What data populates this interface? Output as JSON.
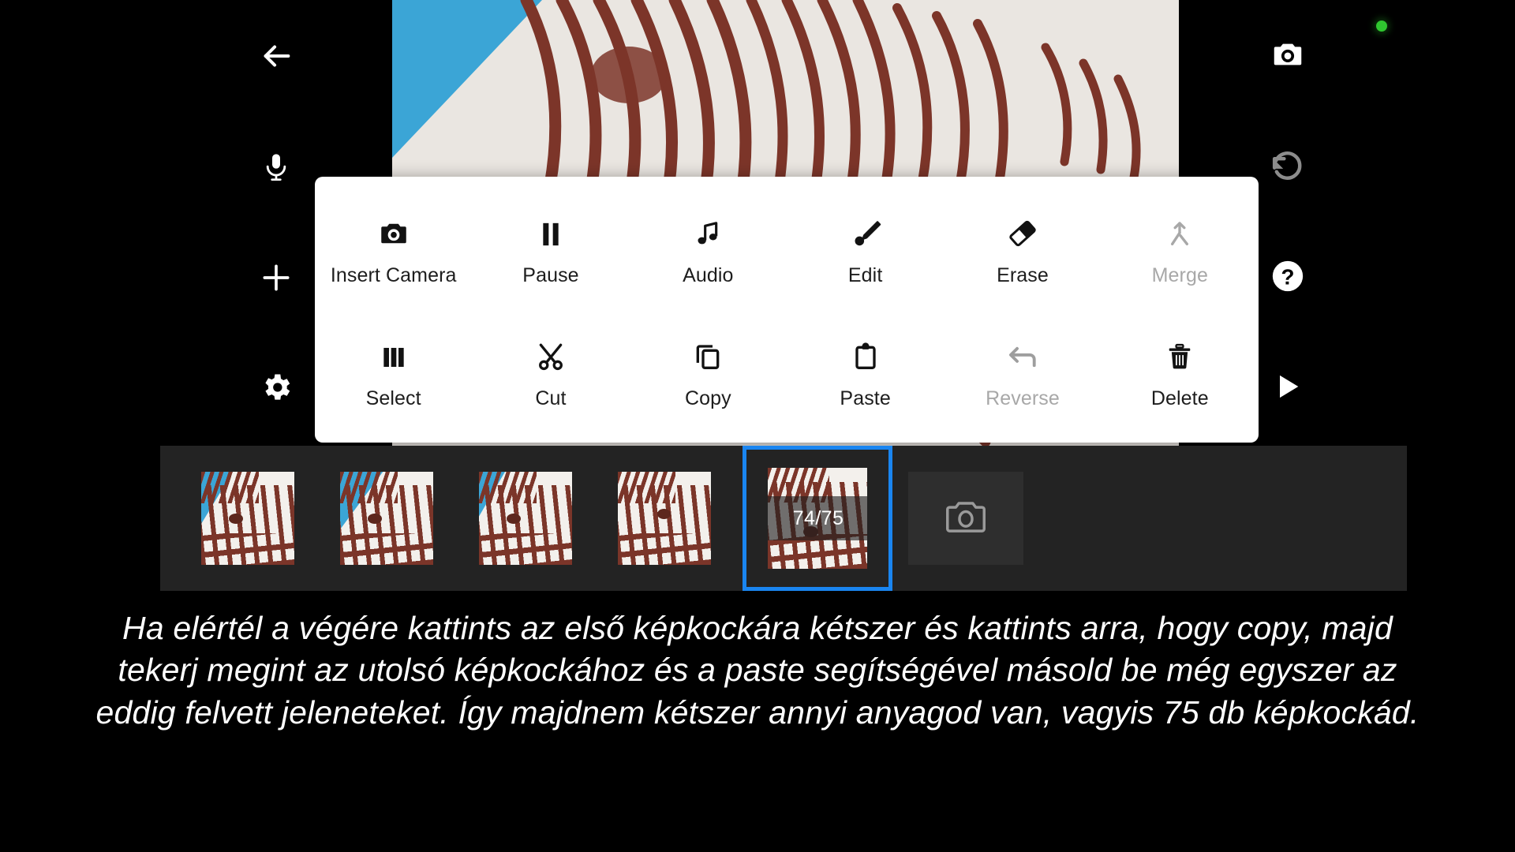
{
  "app": {
    "background_color": "#000000",
    "accent_color": "#1a85f0",
    "status_dot_color": "#2fc72f",
    "disabled_color": "#a8a8a8"
  },
  "status_indicator": {
    "name": "recording-indicator"
  },
  "left_rail": {
    "items": [
      {
        "icon": "back-arrow-icon",
        "label": "Back",
        "enabled": true
      },
      {
        "icon": "microphone-icon",
        "label": "Microphone",
        "enabled": true
      },
      {
        "icon": "plus-icon",
        "label": "Add",
        "enabled": true
      },
      {
        "icon": "settings-gear-icon",
        "label": "Settings",
        "enabled": true
      }
    ]
  },
  "right_rail": {
    "items": [
      {
        "icon": "camera-shutter-icon",
        "label": "Capture",
        "enabled": true
      },
      {
        "icon": "undo-icon",
        "label": "Undo",
        "enabled": false
      },
      {
        "icon": "help-circle-icon",
        "label": "Help",
        "enabled": true
      },
      {
        "icon": "play-icon",
        "label": "Play",
        "enabled": true
      }
    ]
  },
  "action_menu": {
    "rows": [
      [
        {
          "label": "Insert Camera",
          "icon": "camera-icon",
          "enabled": true
        },
        {
          "label": "Pause",
          "icon": "pause-icon",
          "enabled": true
        },
        {
          "label": "Audio",
          "icon": "music-note-icon",
          "enabled": true
        },
        {
          "label": "Edit",
          "icon": "brush-icon",
          "enabled": true
        },
        {
          "label": "Erase",
          "icon": "eraser-icon",
          "enabled": true
        },
        {
          "label": "Merge",
          "icon": "merge-icon",
          "enabled": false
        }
      ],
      [
        {
          "label": "Select",
          "icon": "columns-icon",
          "enabled": true
        },
        {
          "label": "Cut",
          "icon": "scissors-icon",
          "enabled": true
        },
        {
          "label": "Copy",
          "icon": "copy-icon",
          "enabled": true
        },
        {
          "label": "Paste",
          "icon": "clipboard-icon",
          "enabled": true
        },
        {
          "label": "Reverse",
          "icon": "reverse-arrow-icon",
          "enabled": false
        },
        {
          "label": "Delete",
          "icon": "trash-icon",
          "enabled": true
        }
      ]
    ]
  },
  "filmstrip": {
    "selected_frame_counter": "74/75",
    "selected_index": 4,
    "frames": [
      {
        "name": "frame-thumbnail-1"
      },
      {
        "name": "frame-thumbnail-2"
      },
      {
        "name": "frame-thumbnail-3"
      },
      {
        "name": "frame-thumbnail-4"
      },
      {
        "name": "frame-thumbnail-5"
      }
    ],
    "add_frame": {
      "icon": "camera-outline-icon",
      "label": "Add frame"
    }
  },
  "caption": {
    "text": "Ha elértél a végére kattints az első képkockára kétszer és kattints arra, hogy copy, majd tekerj megint az utolsó képkockához és a paste segítségével másold be még egyszer az eddig felvett jeleneteket. Így majdnem kétszer annyi anyagod van, vagyis 75 db képkockád."
  }
}
